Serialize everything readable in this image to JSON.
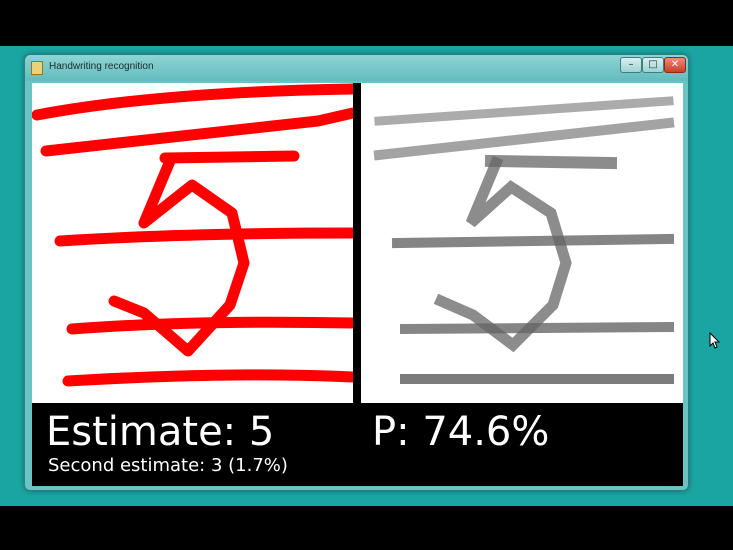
{
  "window": {
    "title": "Handwriting recognition",
    "controls": {
      "minimize": "–",
      "maximize": "□",
      "close": "✕"
    }
  },
  "results": {
    "estimate_text": "Estimate: 5",
    "probability_text": "P: 74.6%",
    "second_estimate_text": "Second estimate: 3 (1.7%)"
  },
  "colors": {
    "desktop": "#1aa5a3",
    "stroke": "#ff0000",
    "pixelated": "#555555"
  },
  "icons": {
    "app": "app-icon",
    "cursor": "mouse-pointer-icon"
  }
}
